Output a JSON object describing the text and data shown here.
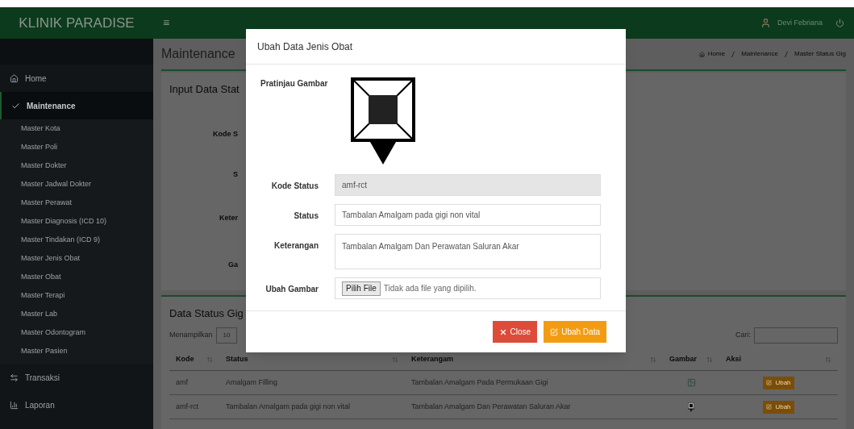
{
  "brand": "KLINIK PARADISE",
  "header": {
    "menu_glyph": "≡",
    "user": "Devi Febriana"
  },
  "sidebar": {
    "items": [
      {
        "label": "Home",
        "selected": false
      },
      {
        "label": "Maintenance",
        "selected": true,
        "children": [
          "Master Kota",
          "Master Poli",
          "Master Dokter",
          "Master Jadwal Dokter",
          "Master Perawat",
          "Master Diagnosis (ICD 10)",
          "Master Tindakan (ICD 9)",
          "Master Jenis Obat",
          "Master Obat",
          "Master Terapi",
          "Master Lab",
          "Master Odontogram",
          "Master Pasien"
        ]
      },
      {
        "label": "Transaksi",
        "selected": false
      },
      {
        "label": "Laporan",
        "selected": false
      }
    ]
  },
  "page": {
    "title": "Maintenance",
    "breadcrumb": [
      "Home",
      "Maintenance",
      "Master Status Gig"
    ]
  },
  "input_panel": {
    "title": "Input Data Stat",
    "labels": [
      "Kode S",
      "S",
      "Keter",
      "Ga"
    ]
  },
  "data_panel": {
    "title": "Data Status Gig",
    "show_label": "Menampilkan",
    "page_size": "10",
    "search_label": "Cari:",
    "columns": [
      "Kode",
      "Status",
      "Keterangam",
      "Gambar",
      "Aksi"
    ],
    "rows": [
      {
        "kode": "amf",
        "status": "Amalgam Filling",
        "keterangan": "Tambalan Amalgam Pada Permukaan Gigi",
        "kind": "picture",
        "action": "Ubah"
      },
      {
        "kode": "amf-rct",
        "status": "Tambalan Amalgam pada gigi non vital",
        "keterangan": "Tambalan Amalgam Dan Perawatan Saluran Akar",
        "kind": "marker",
        "action": "Ubah"
      }
    ]
  },
  "modal": {
    "title": "Ubah Data Jenis Obat",
    "preview_label": "Pratinjau Gambar",
    "fields": [
      {
        "label": "Kode Status",
        "kind": "input",
        "value": "amf-rct",
        "disabled": true
      },
      {
        "label": "Status",
        "kind": "input",
        "value": "Tambalan Amalgam pada gigi non vital",
        "disabled": false
      },
      {
        "label": "Keterangan",
        "kind": "textarea",
        "value": "Tambalan Amalgam Dan Perawatan Saluran Akar",
        "disabled": false
      },
      {
        "label": "Ubah Gambar",
        "kind": "file",
        "button": "Pilih File",
        "value": "Tidak ada file yang dipilih."
      }
    ],
    "buttons": [
      {
        "label": "Close",
        "kind": "danger"
      },
      {
        "label": "Ubah Data",
        "kind": "warning"
      }
    ]
  }
}
